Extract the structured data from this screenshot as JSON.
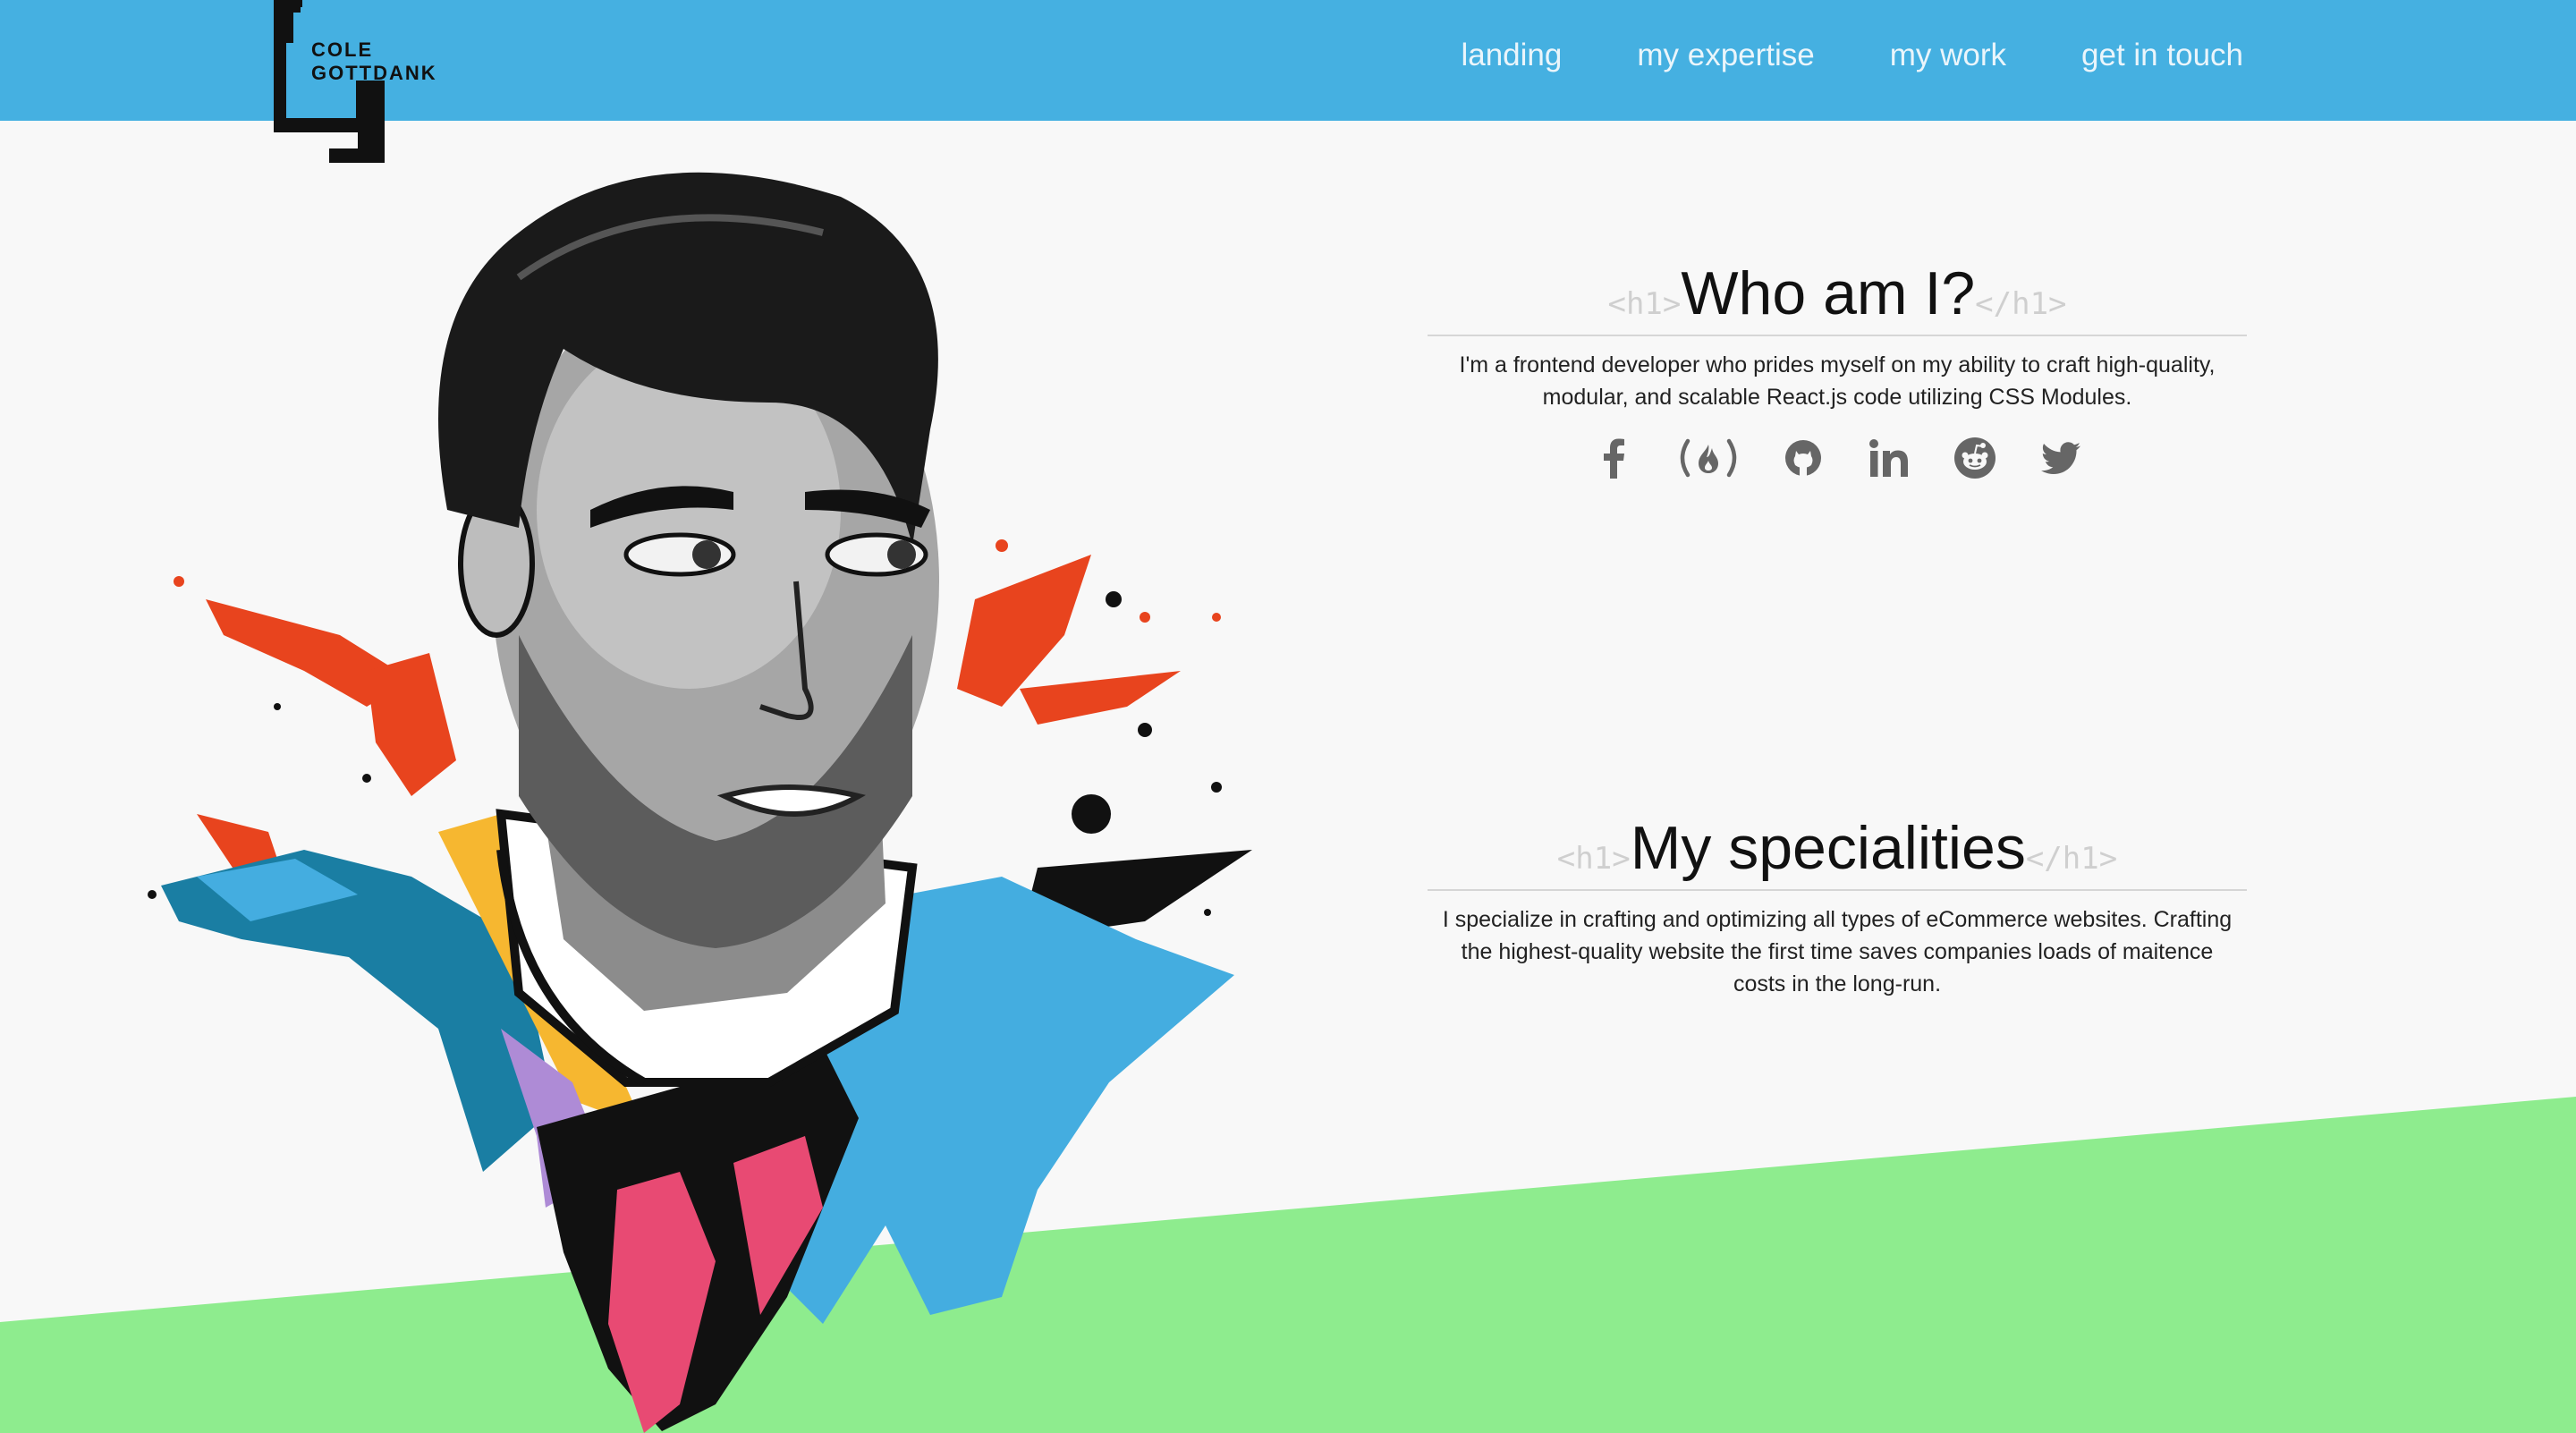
{
  "logo": {
    "line1": "COLE",
    "line2": "GOTTDANK"
  },
  "nav": {
    "items": [
      {
        "label": "landing"
      },
      {
        "label": "my expertise"
      },
      {
        "label": "my work"
      },
      {
        "label": "get in touch"
      }
    ]
  },
  "about": {
    "tag_open": "<h1>",
    "title": "Who am I?",
    "tag_close": "</h1>",
    "body": "I'm a frontend developer who prides myself on my ability to craft high-quality, modular, and scalable React.js code utilizing CSS Modules."
  },
  "social": [
    {
      "icon": "facebook-icon"
    },
    {
      "icon": "freecodecamp-icon"
    },
    {
      "icon": "github-icon"
    },
    {
      "icon": "linkedin-icon"
    },
    {
      "icon": "reddit-icon"
    },
    {
      "icon": "twitter-icon"
    }
  ],
  "specialities": {
    "tag_open": "<h1>",
    "title": "My specialities",
    "tag_close": "</h1>",
    "body": "I specialize in crafting and optimizing all types of eCommerce websites. Crafting the highest-quality website the first time saves companies loads of maitence costs in the long-run."
  },
  "colors": {
    "header": "#45b0e1",
    "background": "#f8f8f8",
    "green_band": "#8eec8e",
    "icon_gray": "#666666",
    "tag_gray": "#cfcfcf"
  }
}
